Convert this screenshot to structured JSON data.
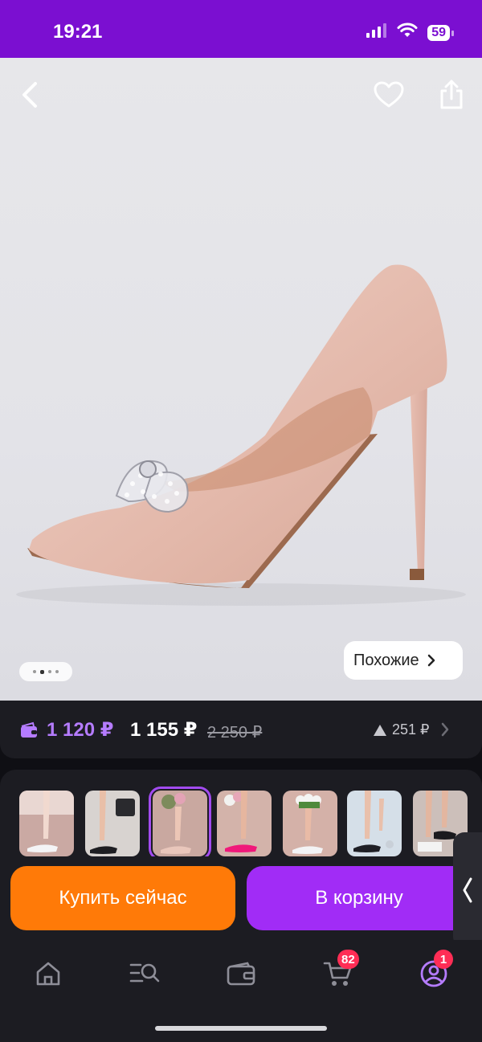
{
  "status_bar": {
    "time": "19:21",
    "battery": "59",
    "icons": [
      "signal-icon",
      "wifi-icon",
      "battery-icon"
    ]
  },
  "header": {
    "icons": [
      "back-icon",
      "heart-icon",
      "share-icon"
    ]
  },
  "gallery": {
    "pagination_dots": 4,
    "active_dot": 2,
    "similar_label": "Похожие"
  },
  "price": {
    "card_price": "1 120 ₽",
    "price": "1 155 ₽",
    "old_price": "2 250 ₽",
    "trend": "251 ₽"
  },
  "thumbnails": {
    "count": 7,
    "selected_index": 2
  },
  "actions": {
    "buy_now": "Купить сейчас",
    "add_to_cart": "В корзину"
  },
  "nav": {
    "items": [
      "home-icon",
      "catalog-search-icon",
      "wallet-icon",
      "cart-icon",
      "profile-icon"
    ],
    "cart_badge": "82",
    "profile_badge": "1"
  },
  "colors": {
    "brand": "#7b0fd1",
    "accent_purple": "#a12cf6",
    "accent_orange": "#ff7a08",
    "card_price": "#b57cff",
    "badge": "#ff2d55"
  }
}
